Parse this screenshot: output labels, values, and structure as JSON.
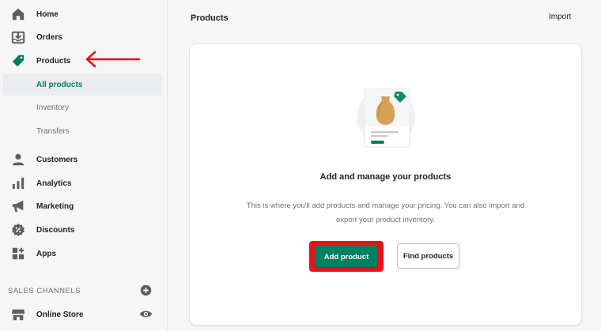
{
  "sidebar": {
    "items": [
      {
        "label": "Home",
        "icon": "home-icon"
      },
      {
        "label": "Orders",
        "icon": "orders-icon"
      },
      {
        "label": "Products",
        "icon": "tag-icon"
      },
      {
        "label": "Customers",
        "icon": "person-icon"
      },
      {
        "label": "Analytics",
        "icon": "bar-chart-icon"
      },
      {
        "label": "Marketing",
        "icon": "megaphone-icon"
      },
      {
        "label": "Discounts",
        "icon": "discount-icon"
      },
      {
        "label": "Apps",
        "icon": "apps-icon"
      }
    ],
    "product_sub_items": [
      {
        "label": "All products",
        "active": true
      },
      {
        "label": "Inventory",
        "active": false
      },
      {
        "label": "Transfers",
        "active": false
      }
    ],
    "sales_channels": {
      "header": "SALES CHANNELS",
      "items": [
        {
          "label": "Online Store",
          "icon": "store-icon"
        }
      ]
    }
  },
  "header": {
    "title": "Products",
    "import_label": "Import"
  },
  "empty_state": {
    "heading": "Add and manage your products",
    "description": "This is where you'll add products and manage your pricing. You can also import and export your product inventory.",
    "primary_label": "Add product",
    "secondary_label": "Find products"
  },
  "colors": {
    "accent": "#008060",
    "active_text": "#007f5f",
    "highlight": "#e3141a",
    "icon": "#5c5f62"
  }
}
